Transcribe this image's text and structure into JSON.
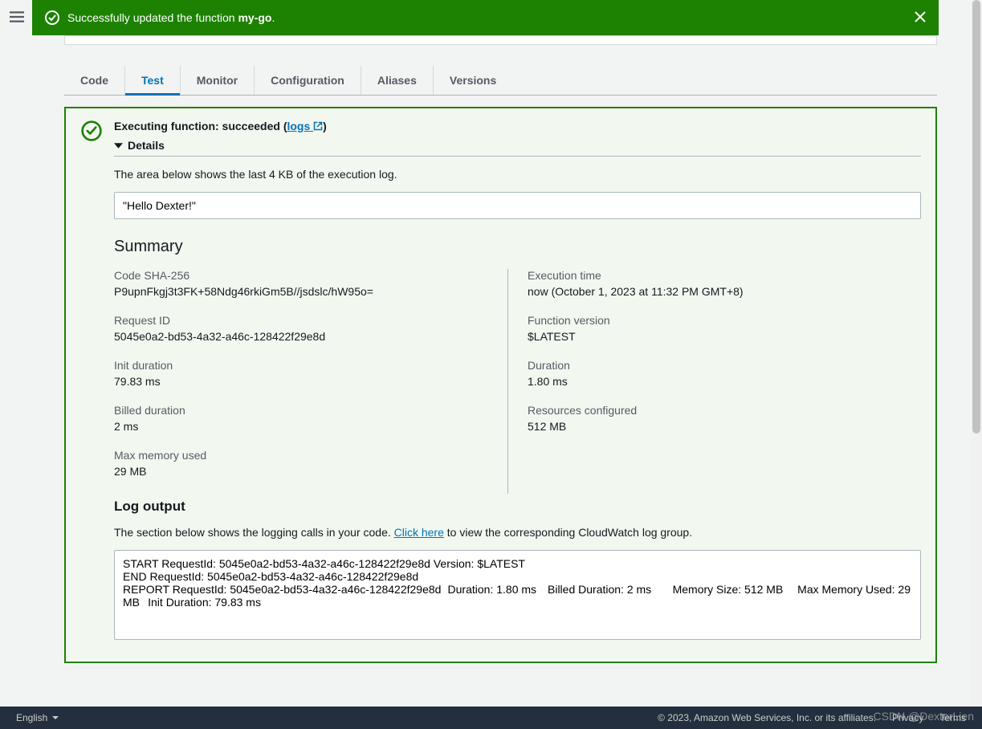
{
  "banner": {
    "prefix": "Successfully updated the function ",
    "name": "my-go",
    "period": "."
  },
  "tabs": [
    "Code",
    "Test",
    "Monitor",
    "Configuration",
    "Aliases",
    "Versions"
  ],
  "activeTab": 1,
  "result": {
    "exec_prefix": "Executing function: succeeded (",
    "logs_label": "logs",
    "exec_suffix": ")",
    "details_label": "Details",
    "log_note": "The area below shows the last 4 KB of the execution log.",
    "output": "\"Hello Dexter!\""
  },
  "summary": {
    "heading": "Summary",
    "left": [
      {
        "label": "Code SHA-256",
        "value": "P9upnFkgj3t3FK+58Ndg46rkiGm5B//jsdslc/hW95o="
      },
      {
        "label": "Request ID",
        "value": "5045e0a2-bd53-4a32-a46c-128422f29e8d"
      },
      {
        "label": "Init duration",
        "value": "79.83 ms"
      },
      {
        "label": "Billed duration",
        "value": "2 ms"
      },
      {
        "label": "Max memory used",
        "value": "29 MB"
      }
    ],
    "right": [
      {
        "label": "Execution time",
        "value": "now (October 1, 2023 at 11:32 PM GMT+8)"
      },
      {
        "label": "Function version",
        "value": "$LATEST"
      },
      {
        "label": "Duration",
        "value": "1.80 ms"
      },
      {
        "label": "Resources configured",
        "value": "512 MB"
      }
    ]
  },
  "logOutput": {
    "heading": "Log output",
    "note_before": "The section below shows the logging calls in your code. ",
    "click_here": "Click here",
    "note_after": " to view the corresponding CloudWatch log group.",
    "content": "START RequestId: 5045e0a2-bd53-4a32-a46c-128422f29e8d Version: $LATEST\nEND RequestId: 5045e0a2-bd53-4a32-a46c-128422f29e8d\nREPORT RequestId: 5045e0a2-bd53-4a32-a46c-128422f29e8d\tDuration: 1.80 ms\tBilled Duration: 2 ms\tMemory Size: 512 MB\tMax Memory Used: 29 MB\tInit Duration: 79.83 ms"
  },
  "footer": {
    "language": "English",
    "copyright": "© 2023, Amazon Web Services, Inc. or its affiliates.",
    "privacy": "Privacy",
    "terms": "Terms"
  },
  "watermark": "CSDN @DexterLien"
}
